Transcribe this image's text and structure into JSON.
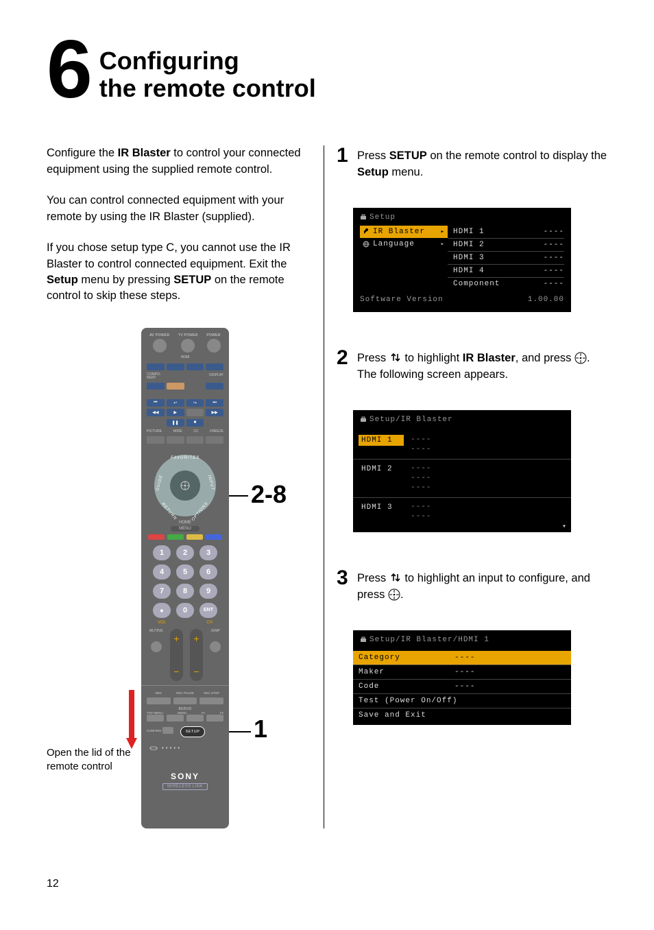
{
  "header": {
    "step_number": "6",
    "title_line1": "Configuring",
    "title_line2": "the remote control"
  },
  "left": {
    "intro1_pre": "Configure the ",
    "intro1_bold": "IR Blaster",
    "intro1_post": " to control your connected equipment using the supplied remote control.",
    "intro2": "You can control connected equipment with your remote by using the IR Blaster (supplied).",
    "intro3_pre": "If you chose setup type C, you cannot use the IR Blaster to control connected equipment. Exit the ",
    "intro3_b1": "Setup",
    "intro3_mid": " menu by pressing ",
    "intro3_b2": "SETUP",
    "intro3_post": " on the remote control to skip these steps.",
    "lid_caption": "Open the lid of the remote control"
  },
  "step1": {
    "num": "1",
    "pre": "Press ",
    "b1": "SETUP",
    "mid": " on the remote control to display the ",
    "b2": "Setup",
    "post": " menu."
  },
  "step2": {
    "num": "2",
    "pre": "Press ",
    "mid": " to highlight ",
    "b1": "IR Blaster",
    "mid2": ", and press ",
    "post": ". The following screen appears."
  },
  "step3": {
    "num": "3",
    "pre": "Press ",
    "mid": " to highlight an input to configure, and press ",
    "post": "."
  },
  "screen1": {
    "title": "Setup",
    "items": [
      {
        "label": "IR Blaster",
        "selected": true
      },
      {
        "label": "Language",
        "selected": false
      }
    ],
    "values": [
      {
        "name": "HDMI 1",
        "val": "----"
      },
      {
        "name": "HDMI 2",
        "val": "----"
      },
      {
        "name": "HDMI 3",
        "val": "----"
      },
      {
        "name": "HDMI 4",
        "val": "----"
      },
      {
        "name": "Component",
        "val": "----"
      }
    ],
    "sw_label": "Software Version",
    "sw_val": "1.00.00"
  },
  "screen2": {
    "title": "Setup/IR Blaster",
    "rows": [
      {
        "label": "HDMI 1",
        "selected": true,
        "lines": "----\n----"
      },
      {
        "label": "HDMI 2",
        "selected": false,
        "lines": "----\n----\n----"
      },
      {
        "label": "HDMI 3",
        "selected": false,
        "lines": "----\n----"
      }
    ]
  },
  "screen3": {
    "title": "Setup/IR Blaster/HDMI 1",
    "rows": [
      {
        "label": "Category",
        "val": "----",
        "selected": true
      },
      {
        "label": "Maker",
        "val": "----",
        "selected": false
      },
      {
        "label": "Code",
        "val": "----",
        "selected": false
      },
      {
        "label": "Test (Power On/Off)",
        "val": "",
        "selected": false
      },
      {
        "label": "Save and Exit",
        "val": "",
        "selected": false
      }
    ]
  },
  "remote": {
    "power_labels": [
      "AV POWER",
      "TV POWER",
      "POWER"
    ],
    "top_labels_left": "COMPO-\nNENT",
    "top_labels_right": "DISPLAY",
    "picture_labels": [
      "PICTURE",
      "WIDE",
      "CC",
      "FREEZE"
    ],
    "dpad": {
      "top": "FAVORITES",
      "left": "GUIDE",
      "right": "INPUT",
      "bot_l": "RETURN",
      "bot_r": "OPTIONS"
    },
    "home": "HOME",
    "menu": "MENU",
    "numkeys": [
      "1",
      "2",
      "3",
      "4",
      "5",
      "6",
      "7",
      "8",
      "9",
      "•",
      "0",
      "ENT"
    ],
    "vol": "VOL",
    "ch": "CH",
    "muting": "MUTING",
    "jump": "JUMP",
    "rec_labels": [
      "REC",
      "REC PAUSE",
      "REC STOP"
    ],
    "bd_labels": "BD/DVD",
    "f_labels": [
      "TOP MENU",
      "MENU",
      "F1",
      "F2"
    ],
    "confirm": "CONFIRM",
    "setup": "SETUP",
    "sony": "SONY",
    "wireless": "WIRELESS LINK"
  },
  "callouts": {
    "dpad": "2-8",
    "setup": "1"
  },
  "page_number": "12"
}
